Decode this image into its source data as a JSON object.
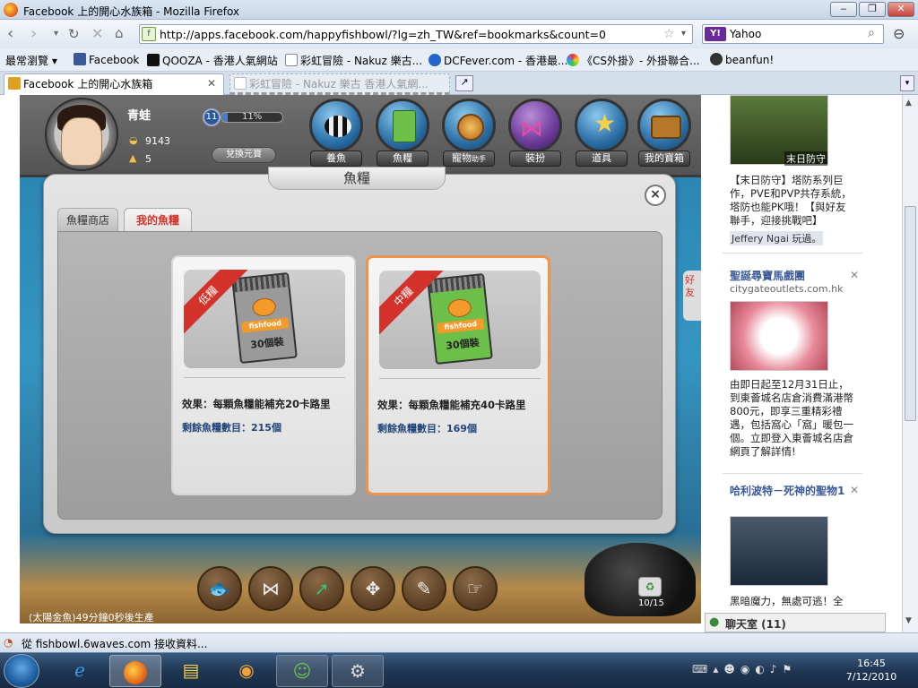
{
  "window": {
    "title": "Facebook 上的開心水族箱 - Mozilla Firefox"
  },
  "nav": {
    "url": "http://apps.facebook.com/happyfishbowl/?lg=zh_TW&ref=bookmarks&count=0",
    "search_value": "Yahoo"
  },
  "bookmarks": [
    {
      "label": "最常瀏覽",
      "color": "#e8eef6"
    },
    {
      "label": "Facebook",
      "color": "#3b5998"
    },
    {
      "label": "QOOZA - 香港人氣網站",
      "color": "#111111"
    },
    {
      "label": "彩虹冒險 - Nakuz 樂古...",
      "color": "#ffffff"
    },
    {
      "label": "DCFever.com - 香港最...",
      "color": "#2266cc"
    },
    {
      "label": "《CS外掛》- 外掛聯合...",
      "color": "#44aa44"
    },
    {
      "label": "beanfun!",
      "color": "#333333"
    }
  ],
  "tabs": [
    {
      "label": "Facebook 上的開心水族箱"
    },
    {
      "label": "彩虹冒險 - Nakuz 樂古 香港人氣網..."
    }
  ],
  "player": {
    "name": "青蛙",
    "shells": "9143",
    "gold": "5",
    "level": "11",
    "xp_text": "11%",
    "xp_fraction": 0.11,
    "exchange_label": "兌換元寶"
  },
  "hud_buttons": [
    {
      "label": "養魚",
      "icon": "fish-icon"
    },
    {
      "label": "魚糧",
      "icon": "food-icon"
    },
    {
      "label": "寵物",
      "sub": "助手",
      "icon": "snail-icon"
    },
    {
      "label": "裝扮",
      "icon": "bow-icon"
    },
    {
      "label": "道具",
      "icon": "wand-icon"
    },
    {
      "label": "我的寶箱",
      "icon": "chest-icon"
    }
  ],
  "dialog": {
    "title": "魚糧",
    "close": "×",
    "tabs": [
      {
        "label": "魚糧商店",
        "active": false
      },
      {
        "label": "我的魚糧",
        "active": true
      }
    ],
    "items": [
      {
        "ribbon": "低糧",
        "bag_color": "#9a9a9a",
        "brand": "fishfood",
        "pcs": "30個裝",
        "effect": "效果：每顆魚糧能補充20卡路里",
        "remain": "剩餘魚糧數目：215個",
        "selected": false
      },
      {
        "ribbon": "中糧",
        "bag_color": "#6cc04a",
        "brand": "fishfood",
        "pcs": "30個裝",
        "effect": "效果：每顆魚糧能補充40卡路里",
        "remain": "剩餘魚糧數目：169個",
        "selected": true
      }
    ]
  },
  "game": {
    "status": "(太陽金魚)49分鐘0秒後生產",
    "counter": "10/15",
    "side_tab": "好友"
  },
  "ads": [
    {
      "title": "",
      "text": "【末日防守】塔防系列巨作，PVE和PVP共存系統，塔防也能PK哦！【與好友聯手，迎接挑戰吧】",
      "caption": "末日防守",
      "played": "Jeffery Ngai 玩過。"
    },
    {
      "title": "聖誕尋寶馬戲團",
      "url": "citygateoutlets.com.hk",
      "text": "由即日起至12月31日止，到東薈城名店倉消費滿港幣800元，即享三重精彩禮遇，包括窩心「窩」暖包一個。立即登入東薈城名店倉網頁了解詳情!"
    },
    {
      "title": "哈利波特－死神的聖物1",
      "text": "黑暗魔力，無處可逃！全"
    }
  ],
  "chat": {
    "label": "聊天室 (11)"
  },
  "status": {
    "text": "從 fishbowl.6waves.com 接收資料..."
  },
  "clock": {
    "time": "16:45",
    "date": "7/12/2010"
  }
}
